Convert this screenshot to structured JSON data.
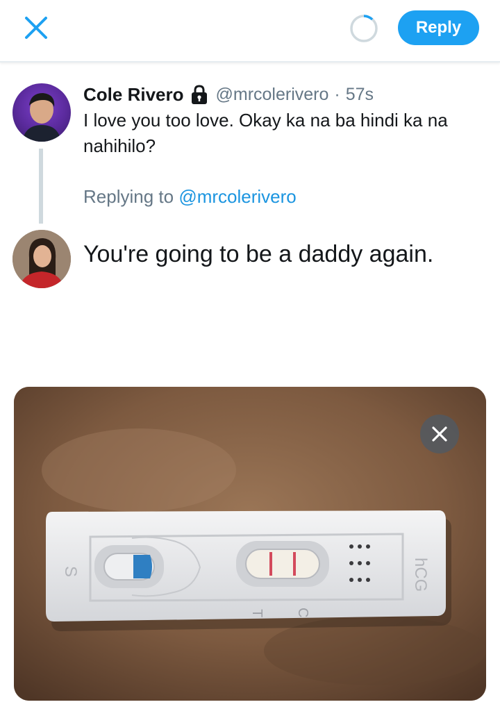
{
  "header": {
    "reply_label": "Reply"
  },
  "original_tweet": {
    "author_name": "Cole Rivero",
    "handle": "@mrcolerivero",
    "separator": "·",
    "time": "57s",
    "text": "I love you too love. Okay ka na ba hindi ka na nahihilo?"
  },
  "replying": {
    "prefix": "Replying to ",
    "mention": "@mrcolerivero"
  },
  "compose": {
    "text": "You're going to be a daddy again."
  },
  "media": {
    "test_labels": [
      "S",
      "C",
      "T",
      "hCG"
    ]
  },
  "colors": {
    "accent": "#1da1f2",
    "link": "#1b95e0",
    "muted": "#657786"
  },
  "icons": {
    "close": "close-icon",
    "spinner": "progress-ring-icon",
    "lock": "lock-icon",
    "remove_media": "close-icon"
  }
}
